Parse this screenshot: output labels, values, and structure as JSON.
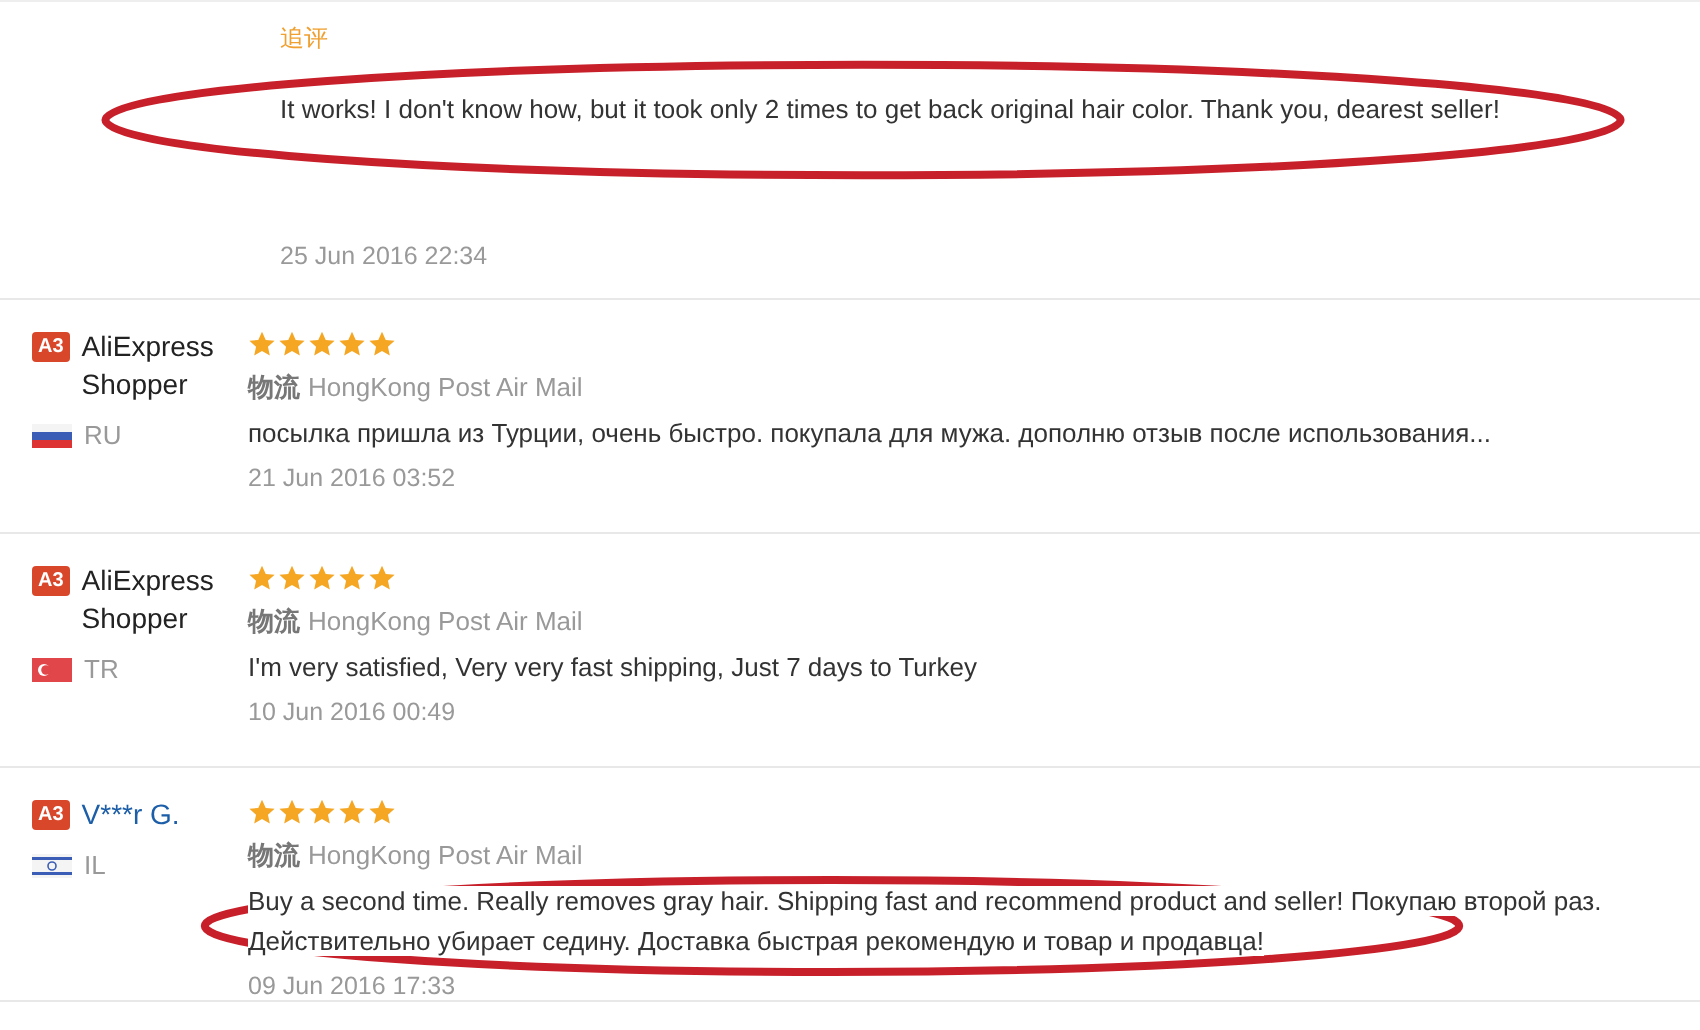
{
  "followup": {
    "label": "追评",
    "text": "It works! I don't know how, but it took only 2 times to get back original hair color. Thank you, dearest seller!",
    "circled": true,
    "date": "25 Jun 2016 22:34"
  },
  "reviews": [
    {
      "badge": "A3",
      "name": {
        "text": "AliExpress Shopper",
        "kind": "plain"
      },
      "flag": {
        "kind": "tricolor"
      },
      "country": "RU",
      "stars": 5,
      "shipping_label": "物流",
      "shipping": "HongKong Post Air Mail",
      "text": "посылка пришла из Турции, очень быстро. покупала для мужа. дополню отзыв после использования...",
      "circled": false,
      "date": "21 Jun 2016 03:52"
    },
    {
      "badge": "A3",
      "name": {
        "text": "AliExpress Shopper",
        "kind": "plain"
      },
      "flag": {
        "kind": "crescent"
      },
      "country": "TR",
      "stars": 5,
      "shipping_label": "物流",
      "shipping": "HongKong Post Air Mail",
      "text": "I'm very satisfied, Very very fast shipping, Just 7 days to Turkey",
      "circled": false,
      "date": "10 Jun 2016 00:49"
    },
    {
      "badge": "A3",
      "name": {
        "text": "V***r G.",
        "kind": "link"
      },
      "flag": {
        "kind": "star"
      },
      "country": "IL",
      "stars": 5,
      "shipping_label": "物流",
      "shipping": "HongKong Post Air Mail",
      "text": "Buy a second time. Really removes gray hair. Shipping fast and recommend product and seller! Покупаю второй раз. Действительно убирает седину. Доставка быстрая рекомендую и товар и продавца!",
      "circled": true,
      "date": "09 Jun 2016 17:33"
    }
  ]
}
